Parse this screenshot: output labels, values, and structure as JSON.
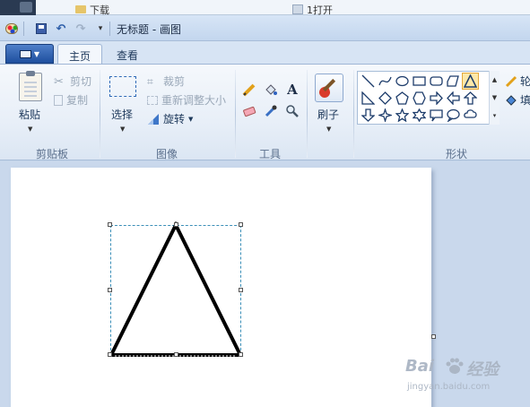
{
  "behind": {
    "left_text": "下载",
    "right_text": "1打开"
  },
  "titlebar": {
    "title": "无标题 - 画图",
    "dropdown_glyph": "▾"
  },
  "tabs": [
    {
      "label": "主页",
      "active": true
    },
    {
      "label": "查看",
      "active": false
    }
  ],
  "clipboard": {
    "paste": "粘贴",
    "cut": "剪切",
    "copy": "复制",
    "group": "剪贴板"
  },
  "image": {
    "select": "选择",
    "crop": "裁剪",
    "resize": "重新调整大小",
    "rotate": "旋转",
    "group": "图像"
  },
  "tools": {
    "text_tool": "A",
    "group": "工具"
  },
  "brushes": {
    "label": "刷子"
  },
  "shapes": {
    "group": "形状",
    "outline_partial": "轮",
    "fill_partial": "填",
    "selected": "triangle"
  },
  "watermark": {
    "brand": "Bai",
    "brand_suffix": "经验",
    "sub": "jingyan.baidu.com"
  },
  "colors": {
    "accent": "#2e6ab7",
    "ribbon_bg": "#eaf1f9",
    "canvas_bg": "#ffffff",
    "workspace_bg": "#c9d8ec",
    "selection": "#3b8fb8"
  }
}
